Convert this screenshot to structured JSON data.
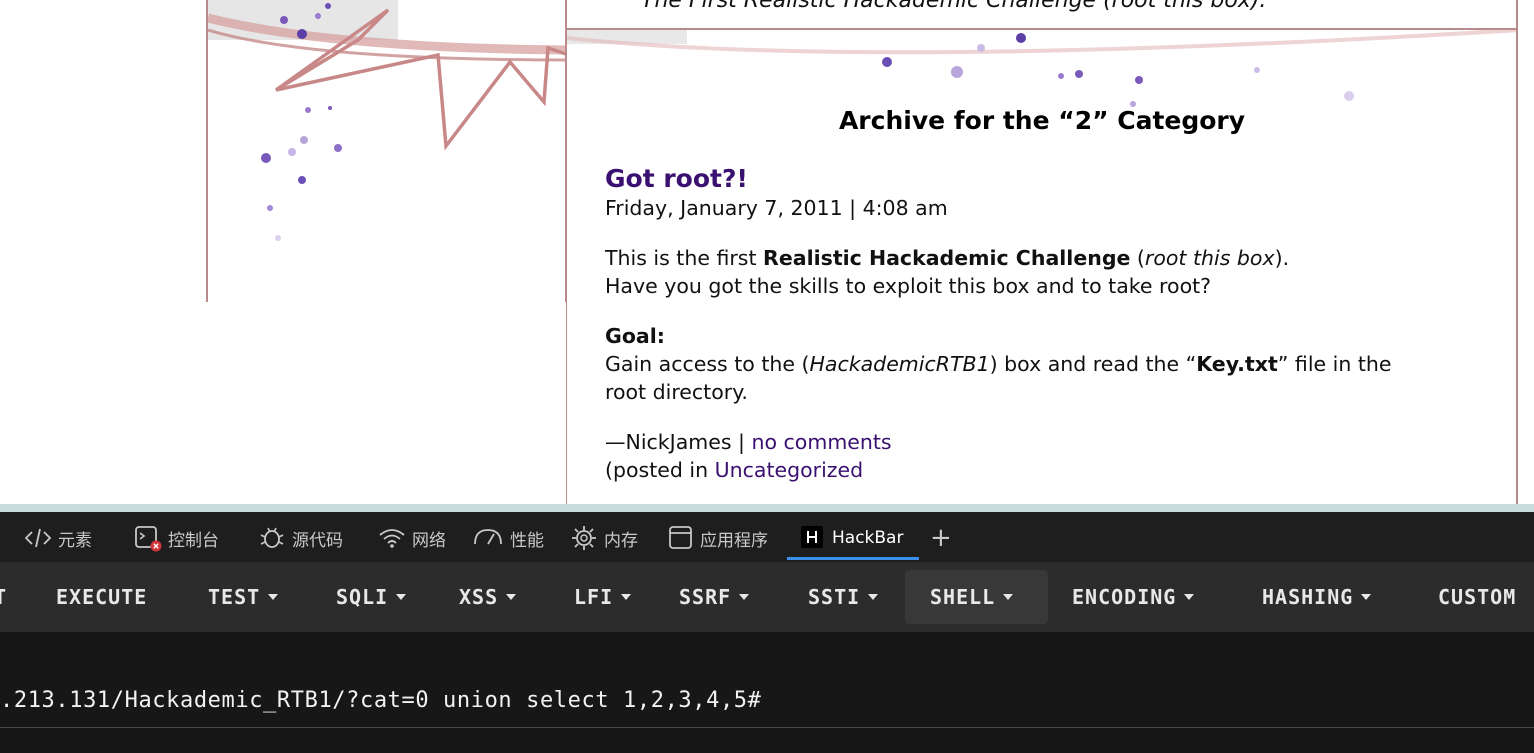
{
  "page": {
    "tagline": "The First Realistic Hackademic Challenge (root this box).",
    "archive_title": "Archive for the “2” Category",
    "post": {
      "title": "Got root?!",
      "date": "Friday, January 7, 2011 | 4:08 am",
      "intro_before": "This is the first ",
      "intro_bold": "Realistic Hackademic Challenge",
      "intro_mid": " (",
      "intro_italic": "root this box",
      "intro_after": ").",
      "intro_line2": "Have you got the skills to exploit this box and to take root?",
      "goal_label": "Goal:",
      "goal_before": "Gain access to the (",
      "goal_italic": "HackademicRTB1",
      "goal_mid": ") box and read the “",
      "goal_bold": "Key.txt",
      "goal_after": "” file in the",
      "goal_line2": "root directory.",
      "author": "—NickJames | ",
      "comments_link": "no comments",
      "posted_in": "(posted in ",
      "category_link": "Uncategorized"
    }
  },
  "devtools": {
    "tabs": [
      {
        "label": "元素",
        "icon": "code-icon"
      },
      {
        "label": "控制台",
        "icon": "console-icon"
      },
      {
        "label": "源代码",
        "icon": "bug-icon"
      },
      {
        "label": "网络",
        "icon": "wifi-icon"
      },
      {
        "label": "性能",
        "icon": "gauge-icon"
      },
      {
        "label": "内存",
        "icon": "chip-icon"
      },
      {
        "label": "应用程序",
        "icon": "window-icon"
      },
      {
        "label": "HackBar",
        "icon": "hackbar-icon"
      }
    ],
    "add_tab": "+",
    "active_tab": "HackBar",
    "active_color": "#3b8eea"
  },
  "hackbar": {
    "menu": {
      "cut_left": "T",
      "execute": "EXECUTE",
      "test": "TEST",
      "sqli": "SQLI",
      "xss": "XSS",
      "lfi": "LFI",
      "ssrf": "SSRF",
      "ssti": "SSTI",
      "shell": "SHELL",
      "encoding": "ENCODING",
      "hashing": "HASHING",
      "custom": "CUSTOM"
    },
    "url": ".213.131/Hackademic_RTB1/?cat=0 union select 1,2,3,4,5#"
  }
}
